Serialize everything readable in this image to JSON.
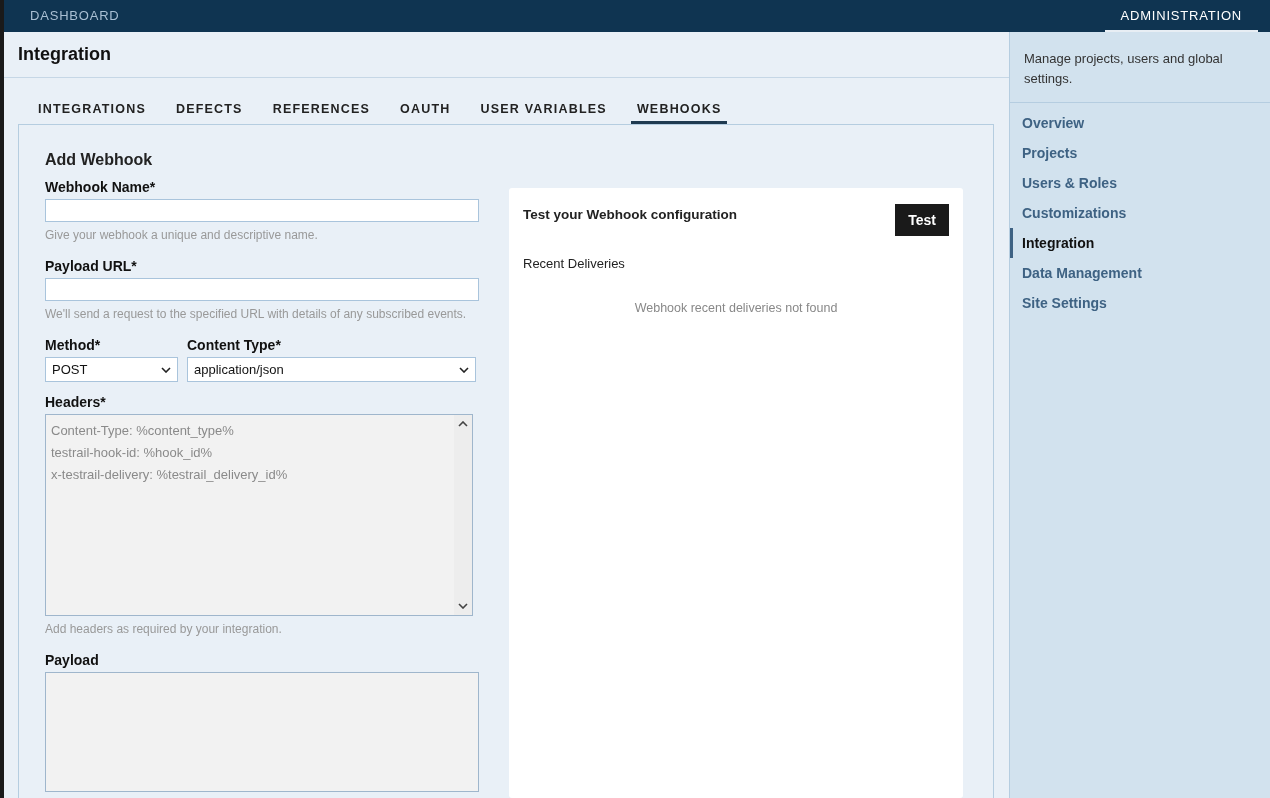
{
  "top_nav": [
    {
      "label": "DASHBOARD",
      "selected": false
    },
    {
      "label": "ADMINISTRATION",
      "selected": true
    }
  ],
  "page_title": "Integration",
  "tabs": [
    {
      "label": "INTEGRATIONS",
      "selected": false
    },
    {
      "label": "DEFECTS",
      "selected": false
    },
    {
      "label": "REFERENCES",
      "selected": false
    },
    {
      "label": "OAUTH",
      "selected": false
    },
    {
      "label": "USER VARIABLES",
      "selected": false
    },
    {
      "label": "WEBHOOKS",
      "selected": true
    }
  ],
  "form": {
    "title": "Add Webhook",
    "webhook_name": {
      "label": "Webhook Name*",
      "hint": "Give your webhook a unique and descriptive name."
    },
    "payload_url": {
      "label": "Payload URL*",
      "hint": "We'll send a request to the specified URL with details of any subscribed events."
    },
    "method": {
      "label": "Method*",
      "value": "POST"
    },
    "content_type": {
      "label": "Content Type*",
      "value": "application/json"
    },
    "headers": {
      "label": "Headers*",
      "disabled": true,
      "lines": [
        "Content-Type: %content_type%",
        "testrail-hook-id: %hook_id%",
        "x-testrail-delivery: %testrail_delivery_id%"
      ],
      "hint": "Add headers as required by your integration."
    },
    "payload": {
      "label": "Payload",
      "disabled": true
    }
  },
  "test_panel": {
    "title": "Test your Webhook configuration",
    "button": "Test",
    "deliveries_title": "Recent Deliveries",
    "empty_message": "Webhook recent deliveries not found"
  },
  "sidebar": {
    "description": "Manage projects, users and global settings.",
    "items": [
      {
        "label": "Overview",
        "selected": false
      },
      {
        "label": "Projects",
        "selected": false
      },
      {
        "label": "Users & Roles",
        "selected": false
      },
      {
        "label": "Customizations",
        "selected": false
      },
      {
        "label": "Integration",
        "selected": true
      },
      {
        "label": "Data Management",
        "selected": false
      },
      {
        "label": "Site Settings",
        "selected": false
      }
    ]
  }
}
